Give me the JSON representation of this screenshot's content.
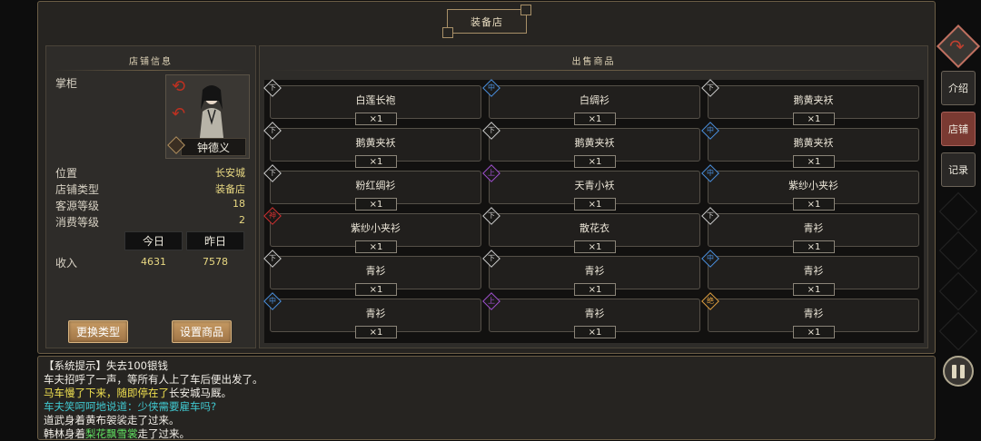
{
  "shop_title": "装备店",
  "shop_info": {
    "section_title": "店铺信息",
    "owner_label": "掌柜",
    "owner_name": "钟德义",
    "rows": [
      {
        "label": "位置",
        "value": "长安城"
      },
      {
        "label": "店铺类型",
        "value": "装备店"
      },
      {
        "label": "客源等级",
        "value": "18"
      },
      {
        "label": "消费等级",
        "value": "2"
      }
    ],
    "today_label": "今日",
    "yesterday_label": "昨日",
    "income_label": "收入",
    "income_today": "4631",
    "income_yesterday": "7578",
    "change_type_button": "更换类型",
    "set_goods_button": "设置商品"
  },
  "goods": {
    "section_title": "出售商品",
    "items": [
      {
        "name": "白莲长袍",
        "qty": "×1",
        "grade": "下",
        "grade_color": "#cccccc"
      },
      {
        "name": "白绸衫",
        "qty": "×1",
        "grade": "中",
        "grade_color": "#4a90e0"
      },
      {
        "name": "鹅黄夹袄",
        "qty": "×1",
        "grade": "下",
        "grade_color": "#cccccc"
      },
      {
        "name": "鹅黄夹袄",
        "qty": "×1",
        "grade": "下",
        "grade_color": "#cccccc"
      },
      {
        "name": "鹅黄夹袄",
        "qty": "×1",
        "grade": "下",
        "grade_color": "#cccccc"
      },
      {
        "name": "鹅黄夹袄",
        "qty": "×1",
        "grade": "中",
        "grade_color": "#4a90e0"
      },
      {
        "name": "粉红绸衫",
        "qty": "×1",
        "grade": "下",
        "grade_color": "#cccccc"
      },
      {
        "name": "天青小袄",
        "qty": "×1",
        "grade": "上",
        "grade_color": "#a050d0"
      },
      {
        "name": "紫纱小夹衫",
        "qty": "×1",
        "grade": "中",
        "grade_color": "#4a90e0"
      },
      {
        "name": "紫纱小夹衫",
        "qty": "×1",
        "grade": "神",
        "grade_color": "#d03030"
      },
      {
        "name": "散花衣",
        "qty": "×1",
        "grade": "下",
        "grade_color": "#cccccc"
      },
      {
        "name": "青衫",
        "qty": "×1",
        "grade": "下",
        "grade_color": "#cccccc"
      },
      {
        "name": "青衫",
        "qty": "×1",
        "grade": "下",
        "grade_color": "#cccccc"
      },
      {
        "name": "青衫",
        "qty": "×1",
        "grade": "下",
        "grade_color": "#cccccc"
      },
      {
        "name": "青衫",
        "qty": "×1",
        "grade": "中",
        "grade_color": "#4a90e0"
      },
      {
        "name": "青衫",
        "qty": "×1",
        "grade": "中",
        "grade_color": "#4a90e0"
      },
      {
        "name": "青衫",
        "qty": "×1",
        "grade": "上",
        "grade_color": "#a050d0"
      },
      {
        "name": "青衫",
        "qty": "×1",
        "grade": "绝",
        "grade_color": "#e0a040"
      }
    ]
  },
  "log": [
    [
      {
        "t": "【系统提示】失去100银钱",
        "c": ""
      }
    ],
    [
      {
        "t": "车夫招呼了一声，等所有人上了车后便出发了。",
        "c": ""
      }
    ],
    [
      {
        "t": "马车慢了下来，随即停在了",
        "c": "c-yellow"
      },
      {
        "t": "长安城马厩。",
        "c": ""
      }
    ],
    [
      {
        "t": "车夫笑呵呵地说道：少侠需要雇车吗?",
        "c": "c-cyan"
      }
    ],
    [
      {
        "t": "道武身着黄布袈裟走了过来。",
        "c": ""
      }
    ],
    [
      {
        "t": "韩林身着",
        "c": ""
      },
      {
        "t": "梨花飘雪裳",
        "c": "c-green"
      },
      {
        "t": "走了过来。",
        "c": ""
      }
    ]
  ],
  "sidebar": {
    "intro_label": "介绍",
    "shop_label": "店铺",
    "record_label": "记录"
  }
}
